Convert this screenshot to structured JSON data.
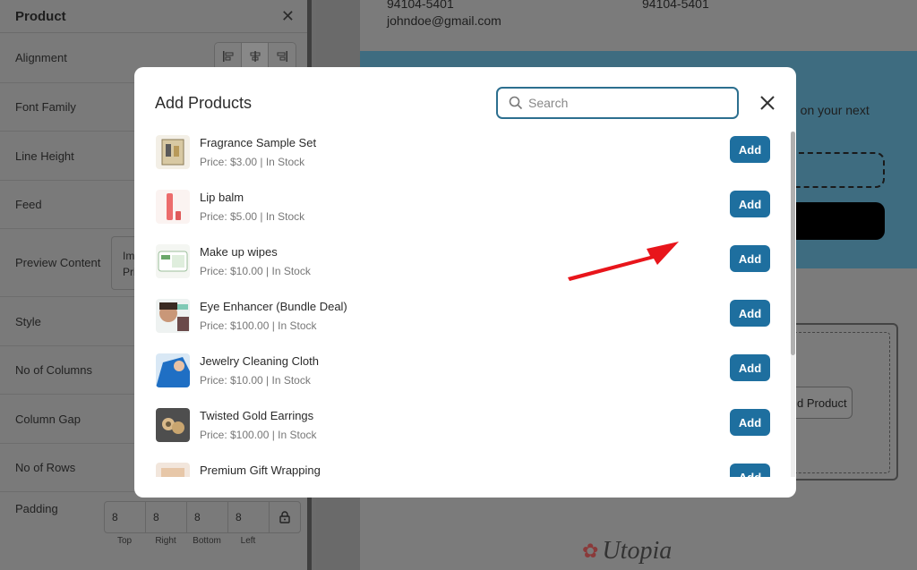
{
  "panel": {
    "title": "Product",
    "rows": [
      "Alignment",
      "Font Family",
      "Line Height",
      "Feed",
      "Preview Content",
      "Style",
      "No of Columns",
      "Column Gap",
      "No of Rows"
    ],
    "preview_text_1": "Im",
    "preview_text_2": "Pri",
    "padding": {
      "label": "Padding",
      "values": [
        "8",
        "8",
        "8",
        "8"
      ],
      "captions": [
        "Top",
        "Right",
        "Bottom",
        "Left"
      ]
    }
  },
  "email": {
    "address_line": "94104-5401",
    "address_line_2": "94104-5401",
    "email": "johndoe@gmail.com",
    "banner_text": "e on your next",
    "add_product_label": "d Product",
    "logo_text": "Utopia"
  },
  "modal": {
    "title": "Add Products",
    "search_placeholder": "Search",
    "add_label": "Add",
    "products": [
      {
        "name": "Fragrance Sample Set",
        "meta": "Price: $3.00  | In Stock"
      },
      {
        "name": "Lip balm",
        "meta": "Price: $5.00  | In Stock"
      },
      {
        "name": "Make up wipes",
        "meta": "Price: $10.00  | In Stock"
      },
      {
        "name": "Eye Enhancer (Bundle Deal)",
        "meta": "Price: $100.00  | In Stock"
      },
      {
        "name": "Jewelry Cleaning Cloth",
        "meta": "Price: $10.00  | In Stock"
      },
      {
        "name": "Twisted Gold Earrings",
        "meta": "Price: $100.00  | In Stock"
      },
      {
        "name": "Premium Gift Wrapping",
        "meta": ""
      }
    ]
  },
  "colors": {
    "accent": "#1e6f9f",
    "search_border": "#2c6f8f",
    "annotation_arrow": "#e8151b"
  }
}
